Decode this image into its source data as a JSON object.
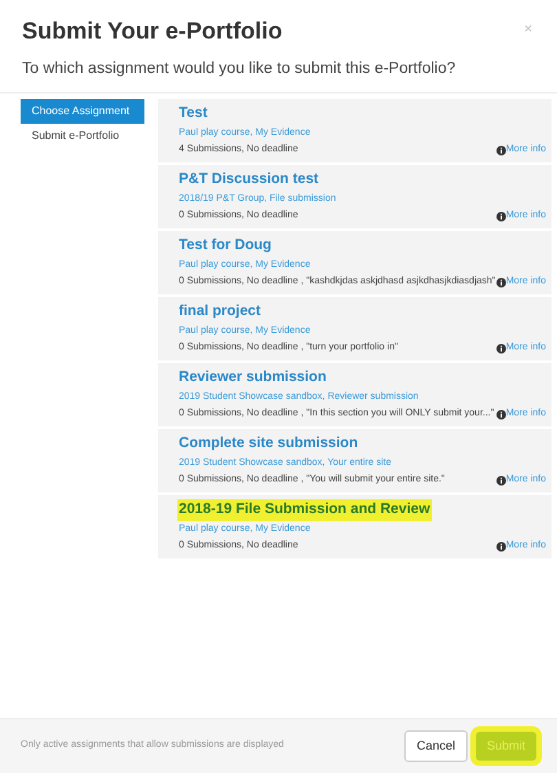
{
  "dialog": {
    "title": "Submit Your e-Portfolio",
    "subtitle": "To which assignment would you like to submit this e-Portfolio?",
    "close": "×"
  },
  "steps": [
    {
      "label": "Choose Assignment",
      "selected": true
    },
    {
      "label": "Submit e-Portfolio",
      "selected": false
    }
  ],
  "assignments": [
    {
      "title": "Test",
      "group": "Paul play course, My Evidence",
      "details": "4 Submissions, No deadline",
      "more_info": "More info",
      "highlighted": false
    },
    {
      "title": "P&T Discussion test",
      "group": "2018/19 P&T Group, File submission",
      "details": "0 Submissions, No deadline",
      "more_info": "More info",
      "highlighted": false
    },
    {
      "title": "Test for Doug",
      "group": "Paul play course, My Evidence",
      "details": "0 Submissions, No deadline , \"kashdkjdas askjdhasd asjkdhasjkdiasdjash\"",
      "more_info": "More info",
      "highlighted": false
    },
    {
      "title": "final project",
      "group": "Paul play course, My Evidence",
      "details": "0 Submissions, No deadline , \"turn your portfolio in\"",
      "more_info": "More info",
      "highlighted": false
    },
    {
      "title": "Reviewer submission",
      "group": "2019 Student Showcase sandbox, Reviewer submission",
      "details": "0 Submissions, No deadline , \"In this section you will ONLY submit your...\"",
      "more_info": "More info",
      "highlighted": false
    },
    {
      "title": "Complete site submission",
      "group": "2019 Student Showcase sandbox, Your entire site",
      "details": "0 Submissions, No deadline , \"You will submit your entire site.\"",
      "more_info": "More info",
      "highlighted": false
    },
    {
      "title": "2018-19 File Submission and Review",
      "group": "Paul play course, My Evidence",
      "details": "0 Submissions, No deadline",
      "more_info": "More info",
      "highlighted": true
    }
  ],
  "footer": {
    "note": "Only active assignments that allow submissions are displayed",
    "cancel": "Cancel",
    "submit": {
      "label": "Submit",
      "highlighted": true
    }
  }
}
